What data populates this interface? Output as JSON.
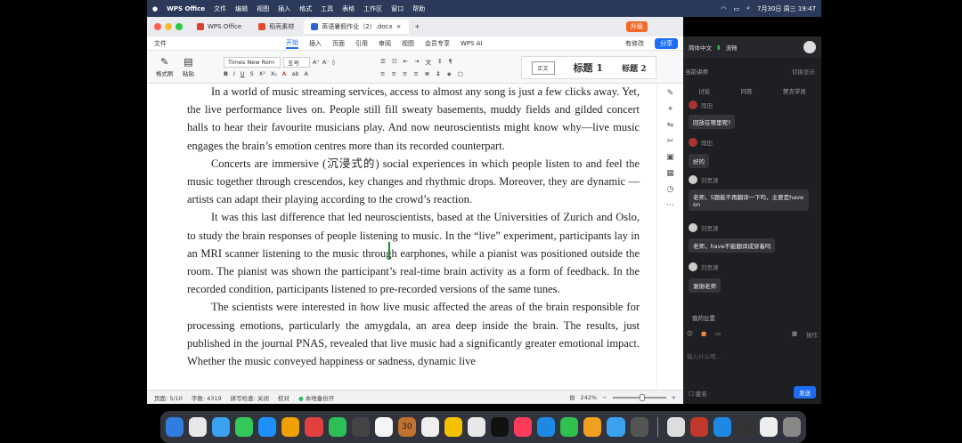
{
  "menubar": {
    "app": "WPS Office",
    "menus": [
      "文件",
      "编辑",
      "视图",
      "插入",
      "格式",
      "工具",
      "表格",
      "工作区",
      "窗口",
      "帮助"
    ],
    "clock": "7月30日 周三  19:47"
  },
  "tabs": [
    {
      "label": "WPS Office",
      "color": "#d9412c"
    },
    {
      "label": "稻壳素材",
      "color": "#e64a2e"
    },
    {
      "label": "英语暑假作业（2）.docx",
      "color": "#2b63d9"
    }
  ],
  "window": {
    "upgrade": "升级"
  },
  "ribbon": {
    "file": "文件",
    "tabs": [
      "开始",
      "插入",
      "页面",
      "引用",
      "审阅",
      "视图",
      "会员专享",
      "WPS AI"
    ],
    "active_tab": "开始",
    "revise": "有修改",
    "share": "分享",
    "font_name": "Times New Rom",
    "font_size": "五号",
    "format_painter": "格式刷",
    "paste": "粘贴",
    "styles": [
      "正文",
      "标题 1",
      "标题 2"
    ]
  },
  "document": {
    "paragraphs": [
      "In a world of music streaming services, access to almost any song is just a few clicks away. Yet, the live performance lives on. People still fill sweaty basements, muddy fields and gilded concert halls to hear their favourite musicians play. And now neuroscientists might know why—live music engages the brain’s emotion centres more than its recorded counterpart.",
      "Concerts are immersive (沉浸式的) social experiences in which people listen to and feel the music together through crescendos, key changes and rhythmic drops. Moreover, they are dynamic — artists can adapt their playing according to the crowd’s reaction.",
      "It was this last difference that led neuroscientists, based at the Universities of Zurich and Oslo, to study the brain responses of people listening to music. In the “live” experiment, participants lay in an MRI scanner listening to the music through earphones, while a pianist was positioned outside the room. The pianist was shown the participant’s real-time brain activity as a form of feedback. In the recorded condition, participants listened to pre-recorded versions of the same tunes.",
      "The scientists were interested in how live music affected the areas of the brain responsible for processing emotions, particularly the amygdala, an area deep inside the brain. The results, just published in the journal PNAS, revealed that live music had a significantly greater emotional impact. Whether the music conveyed happiness or sadness, dynamic live"
    ]
  },
  "status": {
    "page": "页面: 5/10",
    "words": "字数: 4319",
    "spell": "拼写检查: 关闭",
    "proof": "校对",
    "backup": "本地备份开",
    "zoom": "242%"
  },
  "chat": {
    "mode": "简体中文",
    "signal": "流畅",
    "speaker": "当前讲师",
    "switch": "切换显示",
    "tabs": [
      "讨论",
      "问答",
      "禁言学员"
    ],
    "messages": [
      {
        "name": "雨田",
        "text": "回放在哪里呢?"
      },
      {
        "name": "雨田",
        "text": "好的"
      },
      {
        "name": "刘思源",
        "text": "老师，5题能不再翻译一下吗，主要是have on"
      },
      {
        "name": "刘思源",
        "text": "老师，have不能翻译成穿着吗"
      },
      {
        "name": "刘思源",
        "text": "谢谢老师"
      }
    ],
    "my_position": "我的位置",
    "placeholder": "输入什么吧...",
    "anon": "匿名",
    "send": "发送",
    "more": "操作"
  },
  "dock": {
    "apps": [
      "#2f7de1",
      "#e8e8e8",
      "#3aa0f0",
      "#34c759",
      "#1e90ff",
      "#f0a000",
      "#e04040",
      "#2cbf58",
      "#444",
      "#f5f5f5",
      "#c07030",
      "#efefef",
      "#f5c000",
      "#e8e8e8",
      "#111",
      "#ff3b5c",
      "#1e88e5",
      "#30c050",
      "#f0a020",
      "#3aa0f0",
      "#555",
      "#ddd",
      "#c0392b",
      "#1e88e5",
      "#333",
      "#eee",
      "#888"
    ],
    "date_day": "30",
    "date_month": "7月"
  },
  "colors": {
    "accent": "#1b6ef3",
    "menubar": "#2b3a5a"
  }
}
